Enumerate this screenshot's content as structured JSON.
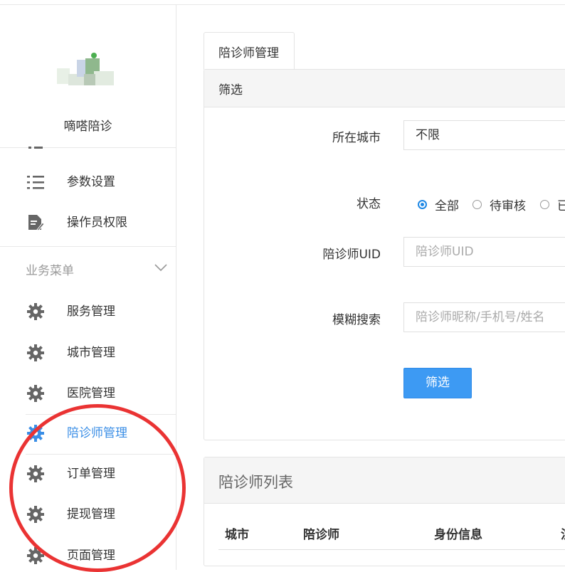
{
  "sidebar": {
    "brand": "嘀嗒陪诊",
    "system_items": [
      {
        "label": "参数设置",
        "icon": "list-icon"
      },
      {
        "label": "操作员权限",
        "icon": "document-edit-icon"
      }
    ],
    "group_title": "业务菜单",
    "items": [
      {
        "label": "服务管理",
        "icon": "gear-icon"
      },
      {
        "label": "城市管理",
        "icon": "gear-icon"
      },
      {
        "label": "医院管理",
        "icon": "gear-icon"
      },
      {
        "label": "陪诊师管理",
        "icon": "gear-icon",
        "active": true
      },
      {
        "label": "订单管理",
        "icon": "gear-icon"
      },
      {
        "label": "提现管理",
        "icon": "gear-icon"
      },
      {
        "label": "页面管理",
        "icon": "gear-icon"
      }
    ]
  },
  "main": {
    "tab_label": "陪诊师管理",
    "filter": {
      "title": "筛选",
      "city_label": "所在城市",
      "city_value": "不限",
      "status_label": "状态",
      "status_options": [
        "全部",
        "待审核",
        "已"
      ],
      "status_selected": "全部",
      "uid_label": "陪诊师UID",
      "uid_placeholder": "陪诊师UID",
      "search_label": "模糊搜索",
      "search_placeholder": "陪诊师昵称/手机号/姓名",
      "submit_label": "筛选"
    },
    "list": {
      "title": "陪诊师列表",
      "columns": [
        "城市",
        "陪诊师",
        "身份信息",
        "注"
      ]
    }
  },
  "colors": {
    "accent": "#3a8ee6",
    "button": "#3d9af3",
    "annotation": "#ea3333"
  }
}
